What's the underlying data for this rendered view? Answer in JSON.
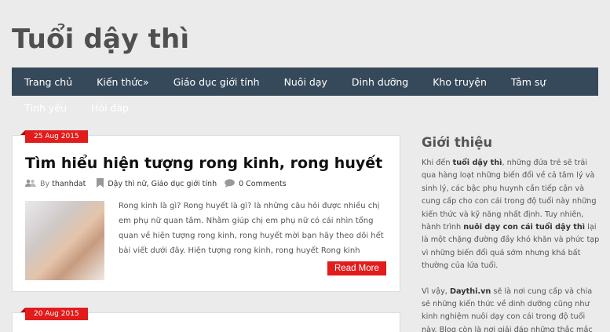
{
  "site": {
    "title": "Tuổi dậy thì"
  },
  "nav": {
    "row1": [
      "Trang chủ",
      "Kiến thức»",
      "Giáo dục giới tính",
      "Nuôi dạy",
      "Dinh dưỡng",
      "Kho truyện",
      "Tâm sự"
    ],
    "row2": [
      "Tình yêu",
      "Hỏi đáp"
    ]
  },
  "posts": [
    {
      "date": "25 Aug 2015",
      "title": "Tìm hiểu hiện tượng rong kinh, rong huyết",
      "by": "By",
      "author": "thanhdat",
      "categories": "Dậy thì nữ, Giáo dục giới tính",
      "comments": "0 Comments",
      "excerpt": "Rong kinh là gì? Rong huyết là gì? là những câu hỏi được nhiều chị em phụ nữ quan tâm. Nhằm giúp chị em phụ nữ có cái nhìn tổng quan về hiện tượng rong kinh, rong huyết mời bạn hãy theo dõi hết bài viết dưới đây. Hiện tượng rong kinh, rong huyết Rong kinh",
      "read_more": "Read More"
    },
    {
      "date": "20 Aug 2015"
    }
  ],
  "sidebar": {
    "title": "Giới thiệu",
    "p1_a": "Khi đến ",
    "p1_b": "tuổi dậy thì",
    "p1_c": ", những đứa trẻ sẽ trải qua hàng loạt những biến đổi về cả tâm lý và sinh lý, các bậc phụ huynh cần tiếp cận và cung cấp cho con cái trong độ tuổi này những kiến thức và kỹ năng nhất định. Tuy nhiên, hành trình ",
    "p1_d": "nuôi dạy con cái tuổi dậy thì",
    "p1_e": " lại là một chặng đường đầy khó khăn và phức tạp vì những biến đổi quá sớm nhưng khá bất thường của lứa tuổi.",
    "p2_a": "Vì vậy, ",
    "p2_b": "Daythi.vn",
    "p2_c": " sẽ là nơi cung cấp và chia sẻ những kiến thức về dinh dưỡng cũng như kinh nghiệm nuôi dạy con cái trong độ tuổi này. Blog còn là nơi giải đáp những thắc mắc"
  },
  "colors": {
    "nav_bg": "#36495a",
    "accent": "#e21b1b"
  }
}
